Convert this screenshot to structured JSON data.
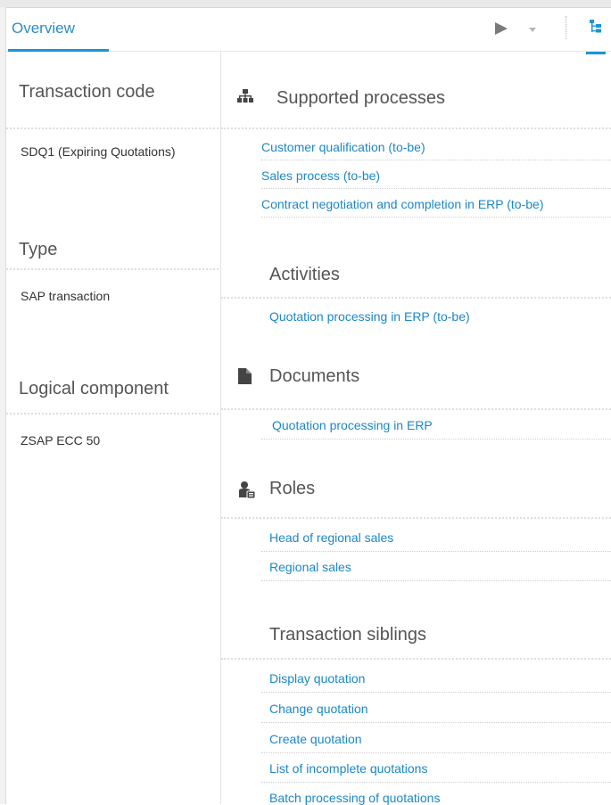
{
  "tabs": {
    "overview_label": "Overview"
  },
  "toolbar": {
    "play_icon": "play-icon",
    "dropdown_icon": "chevron-down-icon",
    "tree_icon": "tree-structure-icon"
  },
  "left": {
    "transaction_code": {
      "title": "Transaction code",
      "value": "SDQ1 (Expiring Quotations)"
    },
    "type": {
      "title": "Type",
      "value": "SAP transaction"
    },
    "logical_component": {
      "title": "Logical component",
      "value": "ZSAP ECC 50"
    }
  },
  "right": {
    "supported_processes": {
      "title": "Supported processes",
      "items": [
        "Customer qualification (to-be)",
        "Sales process (to-be)",
        "Contract negotiation and completion in ERP (to-be)"
      ]
    },
    "activities": {
      "title": "Activities",
      "items": [
        "Quotation processing in ERP (to-be)"
      ]
    },
    "documents": {
      "title": "Documents",
      "items": [
        "Quotation processing in ERP"
      ]
    },
    "roles": {
      "title": "Roles",
      "items": [
        "Head of regional sales",
        "Regional sales"
      ]
    },
    "transaction_siblings": {
      "title": "Transaction siblings",
      "items": [
        "Display quotation",
        "Change quotation",
        "Create quotation",
        "List of incomplete quotations",
        "Batch processing of quotations"
      ]
    }
  }
}
